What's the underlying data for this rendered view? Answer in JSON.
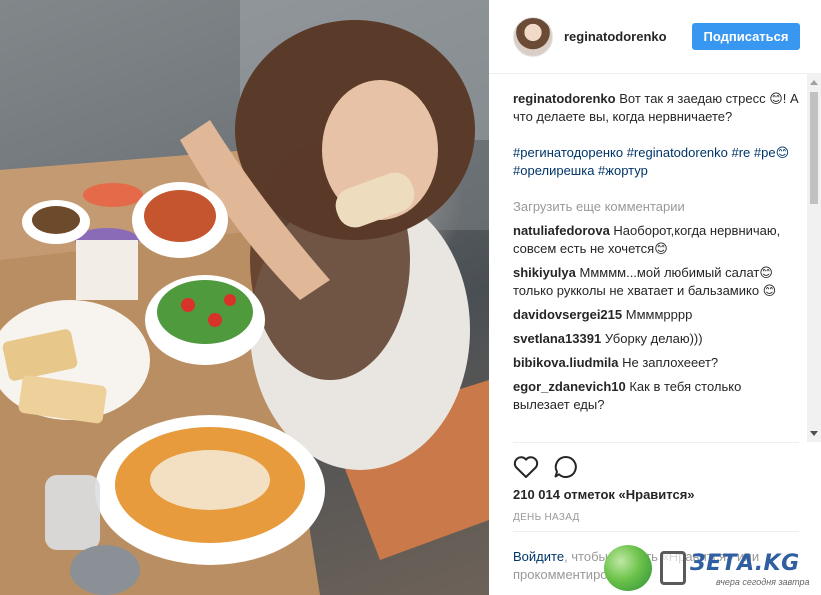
{
  "post": {
    "username": "reginatodorenko",
    "follow_label": "Подписаться"
  },
  "caption": {
    "username": "reginatodorenko",
    "text": "Вот так я заедаю стресс 😊! А что делаете вы, когда нервничаете?",
    "hashtags": "#регинатодоренко #reginatodorenko #re #ре😊 #орелирешка #жортур"
  },
  "load_more_label": "Загрузить еще комментарии",
  "comments": [
    {
      "user": "natuliafedorova",
      "text": "Наоборот,когда нервничаю, совсем есть не хочется😊"
    },
    {
      "user": "shikiyulya",
      "text": "Ммммм...мой любимый салат😊 только рукколы не хватает и бальзамико 😊"
    },
    {
      "user": "davidovsergei215",
      "text": "Ммммрррр"
    },
    {
      "user": "svetlana13391",
      "text": "Уборку делаю)))"
    },
    {
      "user": "bibikova.liudmila",
      "text": "Не заплохееет?"
    },
    {
      "user": "egor_zdanevich10",
      "text": "Как в тебя столько вылезает еды?"
    }
  ],
  "actions": {
    "like_icon": "heart-icon",
    "comment_icon": "comment-bubble-icon"
  },
  "likes_text": "210 014 отметок «Нравится»",
  "time_text": "ДЕНЬ НАЗАД",
  "login_prompt": {
    "link": "Войдите",
    "rest": ", чтобы ставить «Нравится» или прокомментировать."
  },
  "watermark": {
    "brand": "ЗЕТА.KG",
    "tagline": "вчера сегодня завтра"
  },
  "colors": {
    "accent": "#3897f0",
    "link": "#003569",
    "muted": "#999999"
  }
}
